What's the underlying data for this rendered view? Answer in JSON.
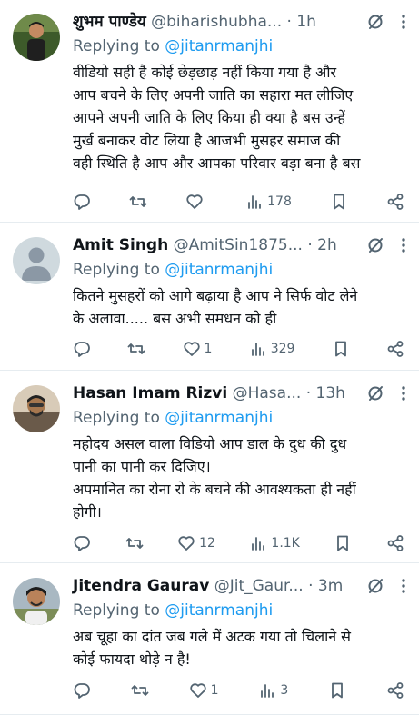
{
  "reply_label": "Replying to",
  "icons": {
    "reply": "reply-icon",
    "retweet": "retweet-icon",
    "like": "heart-icon",
    "views": "views-icon",
    "bookmark": "bookmark-icon",
    "share": "share-icon",
    "grok": "grok-icon",
    "more": "more-icon"
  },
  "tweets": [
    {
      "name": "शुभम पाण्डेय",
      "handle": "@biharishubha...",
      "dot": "·",
      "time": "1h",
      "mention": "@jitanrmanjhi",
      "text": "वीडियो सही है कोई छेड़छाड़ नहीं किया गया है और\nआप बचने के लिए अपनी जाति का सहारा मत लीजिए\nआपने अपनी जाति के लिए किया ही क्या है बस उन्हें\nमुर्ख बनाकर वोट लिया है आजभी मुसहर समाज की\nवही स्थिति है आप और आपका परिवार बड़ा बना है बस",
      "likes": "",
      "views": "178"
    },
    {
      "name": "Amit Singh",
      "handle": "@AmitSin1875...",
      "dot": "·",
      "time": "2h",
      "mention": "@jitanrmanjhi",
      "text": "कितने मुसहरों को आगे बढ़ाया है आप ने सिर्फ वोट लेने\nके अलावा..... बस अभी समधन को ही",
      "likes": "1",
      "views": "329"
    },
    {
      "name": "Hasan Imam Rizvi",
      "handle": "@Hasa...",
      "dot": "·",
      "time": "13h",
      "mention": "@jitanrmanjhi",
      "text": "महोदय असल वाला विडियो आप डाल के दुध की दुध\nपानी का पानी कर दिजिए।\nअपमानित का रोना रो के बचने की आवश्यकता ही नहीं\nहोगी।",
      "likes": "12",
      "views": "1.1K"
    },
    {
      "name": "Jitendra Gaurav",
      "handle": "@Jit_Gaur...",
      "dot": "·",
      "time": "3m",
      "mention": "@jitanrmanjhi",
      "text": "अब चूहा का दांत जब गले में अटक गया तो चिलाने से\nकोई फायदा थोड़े न है!",
      "likes": "1",
      "views": "3"
    }
  ]
}
